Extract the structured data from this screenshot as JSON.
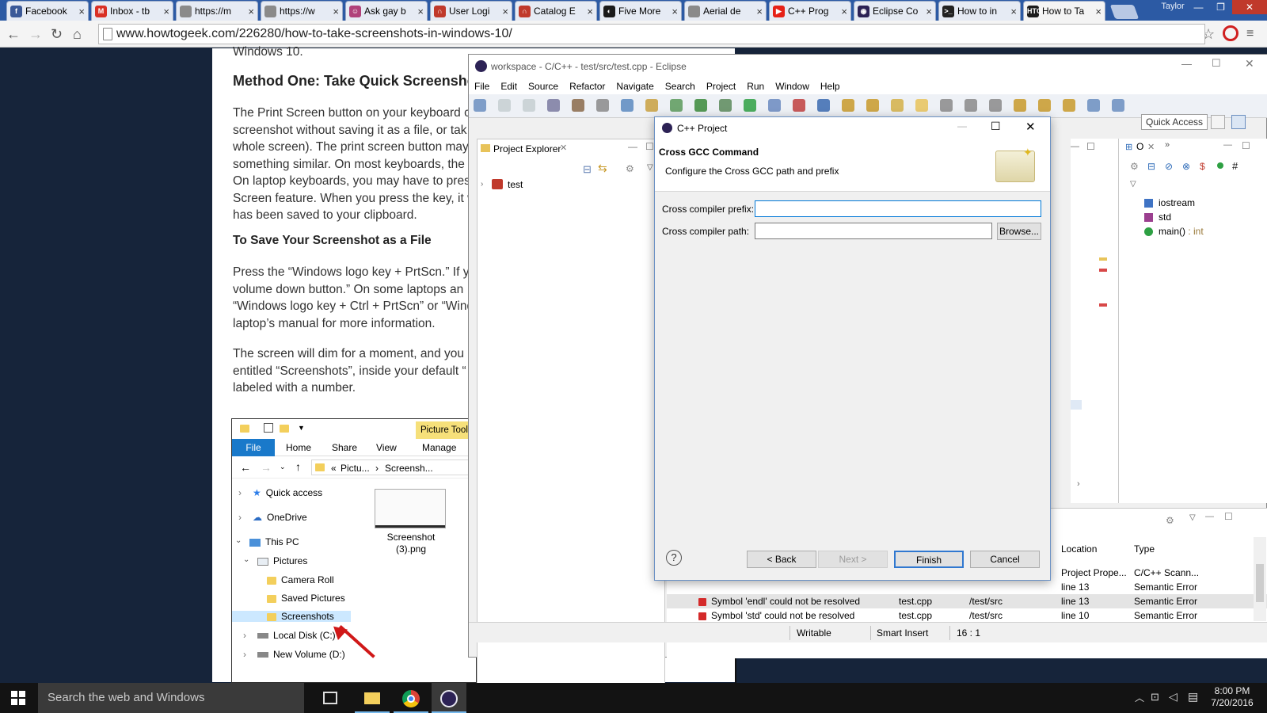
{
  "browser": {
    "tabs": [
      {
        "label": "Facebook",
        "color": "#3b5998",
        "glyph": "f"
      },
      {
        "label": "Inbox - tb",
        "color": "#d93025",
        "glyph": "M"
      },
      {
        "label": "https://m",
        "color": "#8a8a8a",
        "glyph": ""
      },
      {
        "label": "https://w",
        "color": "#8a8a8a",
        "glyph": ""
      },
      {
        "label": "Ask gay b",
        "color": "#b0417a",
        "glyph": "☺"
      },
      {
        "label": "User Logi",
        "color": "#c0392b",
        "glyph": "∩"
      },
      {
        "label": "Catalog E",
        "color": "#c0392b",
        "glyph": "∩"
      },
      {
        "label": "Five More",
        "color": "#1a1a1a",
        "glyph": "◐"
      },
      {
        "label": "Aerial de",
        "color": "#8a8a8a",
        "glyph": ""
      },
      {
        "label": "C++ Prog",
        "color": "#e62117",
        "glyph": "▶"
      },
      {
        "label": "Eclipse Co",
        "color": "#2c2255",
        "glyph": "◉"
      },
      {
        "label": "How to in",
        "color": "#222222",
        "glyph": ">_"
      },
      {
        "label": "How to Ta",
        "color": "#1c1c1c",
        "glyph": "HTG"
      }
    ],
    "profile": "Taylor",
    "url": "www.howtogeek.com/226280/how-to-take-screenshots-in-windows-10/"
  },
  "article": {
    "top_text": "Windows 10.",
    "heading": "Method One: Take Quick Screensho",
    "para1": [
      "The Print Screen button on your keyboard c",
      "screenshot without saving it as a file, or tak",
      "whole screen). The print screen button may",
      "something similar. On most keyboards, the",
      "On laptop keyboards, you may have to pres",
      "Screen feature. When you press the key, it w",
      "has been saved to your clipboard."
    ],
    "subheading": "To Save Your Screenshot as a File",
    "para2": [
      "Press the “Windows logo key + PrtScn.” If yo",
      "volume down button.” On some laptops an",
      "“Windows logo key + Ctrl + PrtScn” or “Wind",
      "laptop’s manual for more information."
    ],
    "para3": [
      "The screen will dim for a moment, and you",
      "entitled “Screenshots”, inside your default “",
      "labeled with a number."
    ]
  },
  "explorer": {
    "context_tab": "Picture Tools",
    "ribbon": [
      "File",
      "Home",
      "Share",
      "View",
      "Manage"
    ],
    "breadcrumb": [
      "«",
      "Pictu...",
      "›",
      "Screensh..."
    ],
    "nav": [
      "Quick access",
      "OneDrive",
      "This PC",
      "Pictures",
      "Camera Roll",
      "Saved Pictures",
      "Screenshots",
      "Local Disk (C:)",
      "New Volume (D:)"
    ],
    "file_name": "Screenshot (3).png"
  },
  "eclipse": {
    "title": "workspace - C/C++ - test/src/test.cpp - Eclipse",
    "menu": [
      "File",
      "Edit",
      "Source",
      "Refactor",
      "Navigate",
      "Search",
      "Project",
      "Run",
      "Window",
      "Help"
    ],
    "quick_access": "Quick Access",
    "project_explorer": {
      "tab": "Project Explorer",
      "project": "test"
    },
    "outline": {
      "tab_label": "O",
      "items": [
        {
          "label": "iostream",
          "type": ""
        },
        {
          "label": "std",
          "type": ""
        },
        {
          "label": "main()",
          "type": " : int"
        }
      ]
    },
    "problems": {
      "columns": [
        "Location",
        "Type"
      ],
      "rows": [
        {
          "desc": "",
          "resource": "",
          "path": "",
          "location": "Project Prope...",
          "type": "C/C++ Scann..."
        },
        {
          "desc": "",
          "resource": "",
          "path": "",
          "location": "line 13",
          "type": "Semantic Error"
        },
        {
          "desc": "Symbol 'endl' could not be resolved",
          "resource": "test.cpp",
          "path": "/test/src",
          "location": "line 13",
          "type": "Semantic Error"
        },
        {
          "desc": "Symbol 'std' could not be resolved",
          "resource": "test.cpp",
          "path": "/test/src",
          "location": "line 10",
          "type": "Semantic Error"
        }
      ]
    },
    "status": {
      "writable": "Writable",
      "insert_mode": "Smart Insert",
      "position": "16 : 1"
    }
  },
  "dialog": {
    "title": "C++ Project",
    "heading": "Cross GCC Command",
    "subtitle": "Configure the Cross GCC path and prefix",
    "prefix_label": "Cross compiler prefix:",
    "prefix_value": "",
    "path_label": "Cross compiler path:",
    "path_value": "",
    "browse": "Browse...",
    "help": "?",
    "back": "< Back",
    "next": "Next >",
    "finish": "Finish",
    "cancel": "Cancel"
  },
  "taskbar": {
    "search_placeholder": "Search the web and Windows",
    "time": "8:00 PM",
    "date": "7/20/2016"
  }
}
